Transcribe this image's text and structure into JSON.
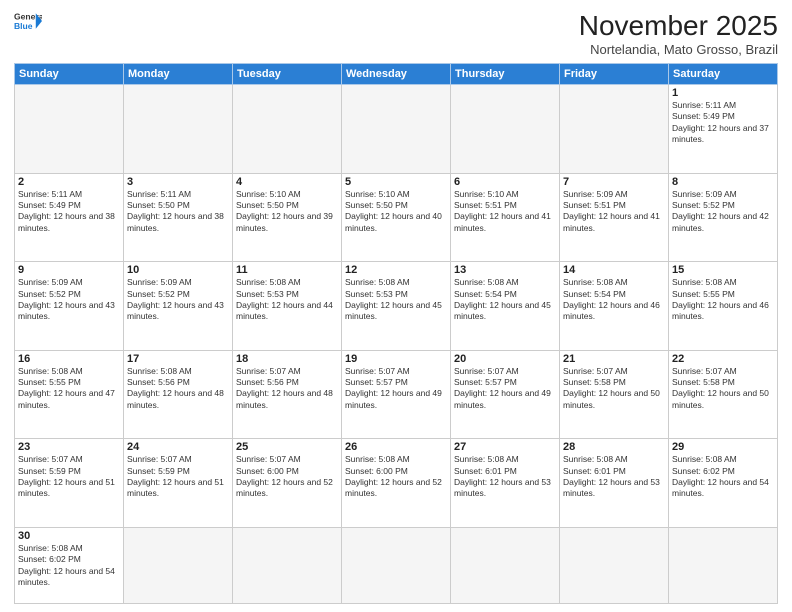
{
  "header": {
    "logo_general": "General",
    "logo_blue": "Blue",
    "month_title": "November 2025",
    "location": "Nortelandia, Mato Grosso, Brazil"
  },
  "days_of_week": [
    "Sunday",
    "Monday",
    "Tuesday",
    "Wednesday",
    "Thursday",
    "Friday",
    "Saturday"
  ],
  "weeks": [
    [
      {
        "day": "",
        "empty": true
      },
      {
        "day": "",
        "empty": true
      },
      {
        "day": "",
        "empty": true
      },
      {
        "day": "",
        "empty": true
      },
      {
        "day": "",
        "empty": true
      },
      {
        "day": "",
        "empty": true
      },
      {
        "day": "1",
        "sunrise": "5:11 AM",
        "sunset": "5:49 PM",
        "daylight": "12 hours and 37 minutes."
      }
    ],
    [
      {
        "day": "2",
        "sunrise": "5:11 AM",
        "sunset": "5:49 PM",
        "daylight": "12 hours and 38 minutes."
      },
      {
        "day": "3",
        "sunrise": "5:11 AM",
        "sunset": "5:50 PM",
        "daylight": "12 hours and 38 minutes."
      },
      {
        "day": "4",
        "sunrise": "5:10 AM",
        "sunset": "5:50 PM",
        "daylight": "12 hours and 39 minutes."
      },
      {
        "day": "5",
        "sunrise": "5:10 AM",
        "sunset": "5:50 PM",
        "daylight": "12 hours and 40 minutes."
      },
      {
        "day": "6",
        "sunrise": "5:10 AM",
        "sunset": "5:51 PM",
        "daylight": "12 hours and 41 minutes."
      },
      {
        "day": "7",
        "sunrise": "5:09 AM",
        "sunset": "5:51 PM",
        "daylight": "12 hours and 41 minutes."
      },
      {
        "day": "8",
        "sunrise": "5:09 AM",
        "sunset": "5:52 PM",
        "daylight": "12 hours and 42 minutes."
      }
    ],
    [
      {
        "day": "9",
        "sunrise": "5:09 AM",
        "sunset": "5:52 PM",
        "daylight": "12 hours and 43 minutes."
      },
      {
        "day": "10",
        "sunrise": "5:09 AM",
        "sunset": "5:52 PM",
        "daylight": "12 hours and 43 minutes."
      },
      {
        "day": "11",
        "sunrise": "5:08 AM",
        "sunset": "5:53 PM",
        "daylight": "12 hours and 44 minutes."
      },
      {
        "day": "12",
        "sunrise": "5:08 AM",
        "sunset": "5:53 PM",
        "daylight": "12 hours and 45 minutes."
      },
      {
        "day": "13",
        "sunrise": "5:08 AM",
        "sunset": "5:54 PM",
        "daylight": "12 hours and 45 minutes."
      },
      {
        "day": "14",
        "sunrise": "5:08 AM",
        "sunset": "5:54 PM",
        "daylight": "12 hours and 46 minutes."
      },
      {
        "day": "15",
        "sunrise": "5:08 AM",
        "sunset": "5:55 PM",
        "daylight": "12 hours and 46 minutes."
      }
    ],
    [
      {
        "day": "16",
        "sunrise": "5:08 AM",
        "sunset": "5:55 PM",
        "daylight": "12 hours and 47 minutes."
      },
      {
        "day": "17",
        "sunrise": "5:08 AM",
        "sunset": "5:56 PM",
        "daylight": "12 hours and 48 minutes."
      },
      {
        "day": "18",
        "sunrise": "5:07 AM",
        "sunset": "5:56 PM",
        "daylight": "12 hours and 48 minutes."
      },
      {
        "day": "19",
        "sunrise": "5:07 AM",
        "sunset": "5:57 PM",
        "daylight": "12 hours and 49 minutes."
      },
      {
        "day": "20",
        "sunrise": "5:07 AM",
        "sunset": "5:57 PM",
        "daylight": "12 hours and 49 minutes."
      },
      {
        "day": "21",
        "sunrise": "5:07 AM",
        "sunset": "5:58 PM",
        "daylight": "12 hours and 50 minutes."
      },
      {
        "day": "22",
        "sunrise": "5:07 AM",
        "sunset": "5:58 PM",
        "daylight": "12 hours and 50 minutes."
      }
    ],
    [
      {
        "day": "23",
        "sunrise": "5:07 AM",
        "sunset": "5:59 PM",
        "daylight": "12 hours and 51 minutes."
      },
      {
        "day": "24",
        "sunrise": "5:07 AM",
        "sunset": "5:59 PM",
        "daylight": "12 hours and 51 minutes."
      },
      {
        "day": "25",
        "sunrise": "5:07 AM",
        "sunset": "6:00 PM",
        "daylight": "12 hours and 52 minutes."
      },
      {
        "day": "26",
        "sunrise": "5:08 AM",
        "sunset": "6:00 PM",
        "daylight": "12 hours and 52 minutes."
      },
      {
        "day": "27",
        "sunrise": "5:08 AM",
        "sunset": "6:01 PM",
        "daylight": "12 hours and 53 minutes."
      },
      {
        "day": "28",
        "sunrise": "5:08 AM",
        "sunset": "6:01 PM",
        "daylight": "12 hours and 53 minutes."
      },
      {
        "day": "29",
        "sunrise": "5:08 AM",
        "sunset": "6:02 PM",
        "daylight": "12 hours and 54 minutes."
      }
    ],
    [
      {
        "day": "30",
        "sunrise": "5:08 AM",
        "sunset": "6:02 PM",
        "daylight": "12 hours and 54 minutes.",
        "last": true
      },
      {
        "day": "",
        "empty": true,
        "last": true
      },
      {
        "day": "",
        "empty": true,
        "last": true
      },
      {
        "day": "",
        "empty": true,
        "last": true
      },
      {
        "day": "",
        "empty": true,
        "last": true
      },
      {
        "day": "",
        "empty": true,
        "last": true
      },
      {
        "day": "",
        "empty": true,
        "last": true
      }
    ]
  ]
}
